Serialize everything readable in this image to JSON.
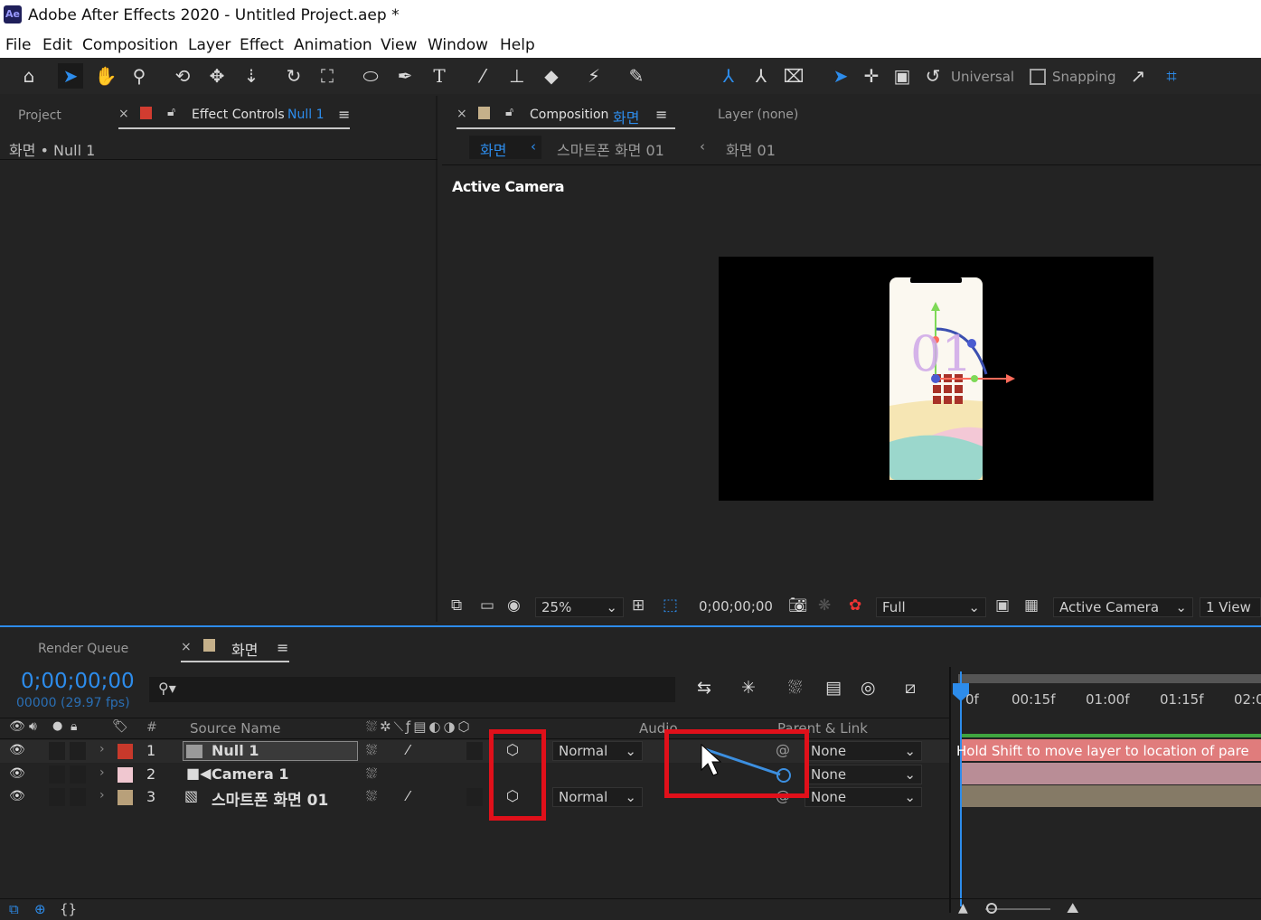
{
  "window": {
    "app_badge": "Ae",
    "title": "Adobe After Effects 2020 - Untitled Project.aep *"
  },
  "menu": [
    "File",
    "Edit",
    "Composition",
    "Layer",
    "Effect",
    "Animation",
    "View",
    "Window",
    "Help"
  ],
  "toolbar": {
    "axis_mode": "Universal",
    "snapping": "Snapping"
  },
  "left_panel": {
    "tab_project": "Project",
    "tab_effect_controls": "Effect Controls",
    "tab_effect_controls_target": "Null 1",
    "breadcrumb": "화면 • Null 1"
  },
  "comp_panel": {
    "tab_label": "Composition",
    "tab_comp_name": "화면",
    "layer_tab": "Layer (none)",
    "crumbs": [
      "화면",
      "스마트폰 화면 01",
      "화면 01"
    ],
    "view_label": "Active Camera",
    "footer": {
      "zoom": "25%",
      "timecode": "0;00;00;00",
      "resolution": "Full",
      "camera": "Active Camera",
      "views": "1 View"
    }
  },
  "timeline": {
    "tab_render_queue": "Render Queue",
    "tab_comp": "화면",
    "timecode": "0;00;00;00",
    "frame_info": "00000 (29.97 fps)",
    "columns": {
      "num": "#",
      "source_name": "Source Name",
      "audio": "Audio",
      "parent_link": "Parent & Link"
    },
    "layers": [
      {
        "num": "1",
        "name": "Null 1",
        "color": "#c8392b",
        "mode": "Normal",
        "parent": "None"
      },
      {
        "num": "2",
        "name": "Camera 1",
        "color": "#f0c7d0",
        "mode": "",
        "parent": "None"
      },
      {
        "num": "3",
        "name": "스마트폰 화면 01",
        "color": "#b8a07a",
        "mode": "Normal",
        "parent": "None"
      }
    ],
    "ruler": [
      "0f",
      "00:15f",
      "01:00f",
      "01:15f",
      "02:0"
    ],
    "tooltip": "Hold Shift to move layer to location of pare"
  },
  "comp_preview": {
    "number_text": "01"
  }
}
